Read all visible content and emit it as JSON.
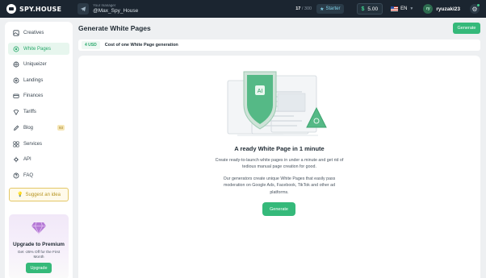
{
  "topbar": {
    "logo_text": "SPY.HOUSE",
    "manager_label": "Your manager",
    "manager_name": "@Max_Spy_House",
    "counter_used": "17",
    "counter_total": "/ 300",
    "plan": "Starter",
    "balance": "5.00",
    "balance_currency": "$",
    "language": "EN",
    "avatar_initials": "ry",
    "username": "ryuzaki23"
  },
  "sidebar": {
    "items": [
      {
        "label": "Creatives",
        "icon": "creatives-icon",
        "active": false
      },
      {
        "label": "White Pages",
        "icon": "white-pages-icon",
        "active": true
      },
      {
        "label": "Uniqueizer",
        "icon": "uniqueizer-icon",
        "active": false
      },
      {
        "label": "Landings",
        "icon": "landings-icon",
        "active": false
      },
      {
        "label": "Finances",
        "icon": "finances-icon",
        "active": false
      },
      {
        "label": "Tariffs",
        "icon": "tariffs-icon",
        "active": false
      },
      {
        "label": "Blog",
        "icon": "blog-icon",
        "active": false,
        "badge": "93"
      },
      {
        "label": "Services",
        "icon": "services-icon",
        "active": false
      },
      {
        "label": "API",
        "icon": "api-icon",
        "active": false
      },
      {
        "label": "FAQ",
        "icon": "faq-icon",
        "active": false
      }
    ],
    "suggest_label": "Suggest an idea",
    "promo": {
      "title": "Upgrade to Premium",
      "subtitle": "Get -25% Off for the First Month",
      "button": "Upgrade"
    }
  },
  "main": {
    "title": "Generate White Pages",
    "header_button": "Generate",
    "cost": {
      "price": "4 USD",
      "label": "Cost of one White Page generation"
    },
    "hero": {
      "title": "A ready White Page in 1 minute",
      "p1": "Create ready-to-launch white pages in under a minute and get rid of tedious manual page creation for good.",
      "p2": "Our generators create unique White Pages that easily pass moderation on Google Ads, Facebook, TikTok and other ad platforms.",
      "button": "Generate",
      "shield_text": "AI"
    }
  },
  "colors": {
    "accent": "#35b97a",
    "topbar": "#1b2530",
    "background": "#eef0f2"
  }
}
